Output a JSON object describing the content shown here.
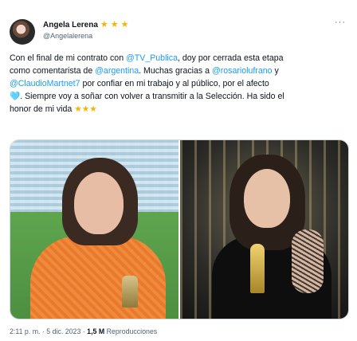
{
  "author": {
    "name": "Angela Lerena",
    "handle": "@Angelalerena",
    "badges": [
      "star",
      "star",
      "star"
    ]
  },
  "menu_icon": "more-horizontal-icon",
  "tweet": {
    "line1_a": "Con el final de mi contrato con ",
    "line1_mention": "@TV_Publica",
    "line1_b": ", doy por cerrada esta etapa",
    "line2_a": "como comentarista de ",
    "line2_mention": "@argentina",
    "line2_b": ". Muchas gracias a ",
    "line2_mention2": "@rosariolufrano",
    "line2_c": " y",
    "line3_mention": "@ClaudioMartnet7",
    "line3_b": " por confiar en mi trabajo y al público, por el afecto",
    "line4_heart": "🩵",
    "line4_b": ". Siempre voy a soñar con volver a transmitir a la Selección. Ha sido el",
    "line5_a": "honor de mi vida",
    "line5_stars": "★★★"
  },
  "media": {
    "left_alt": "photo-stadium",
    "right_alt": "photo-award"
  },
  "meta": {
    "time": "2:11 p. m.",
    "sep": " · ",
    "date": "5 dic. 2023",
    "views_count": "1,5 M",
    "views_label": " Reproducciones"
  },
  "colors": {
    "link": "#1d9bf0",
    "muted": "#536471",
    "star": "#f4b400"
  }
}
